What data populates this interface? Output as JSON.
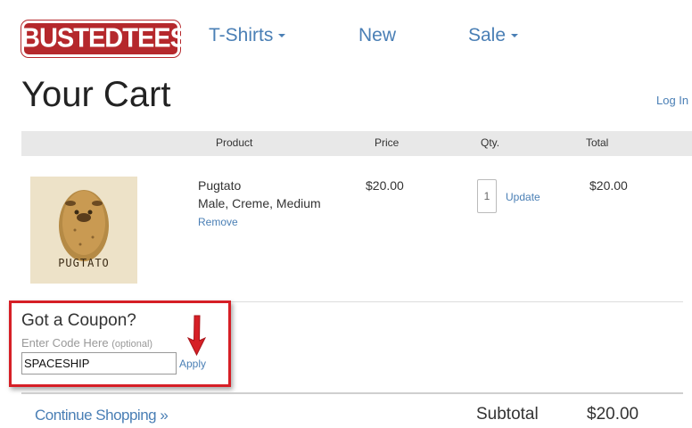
{
  "logo": {
    "text": "BUSTEDTEES"
  },
  "nav": {
    "items": [
      {
        "label": "T-Shirts",
        "has_dropdown": true
      },
      {
        "label": "New",
        "has_dropdown": false
      },
      {
        "label": "Sale",
        "has_dropdown": true
      }
    ]
  },
  "page": {
    "title": "Your Cart",
    "login_label": "Log In"
  },
  "table": {
    "headers": [
      "Product",
      "Price",
      "Qty.",
      "Total"
    ]
  },
  "cart_items": [
    {
      "image_caption": "PUGTATO",
      "name": "Pugtato",
      "variant": "Male, Creme, Medium",
      "remove_label": "Remove",
      "price": "$20.00",
      "quantity": "1",
      "update_label": "Update",
      "total": "$20.00"
    }
  ],
  "coupon": {
    "title": "Got a Coupon?",
    "label": "Enter Code Here",
    "label_hint": "(optional)",
    "code_value": "SPACESHIP",
    "apply_label": "Apply"
  },
  "footer": {
    "continue_label": "Continue Shopping »",
    "subtotal_label": "Subtotal",
    "subtotal_value": "$20.00"
  },
  "colors": {
    "link": "#4a7fb5",
    "brand": "#b5282c",
    "annotation": "#d61f26",
    "header_bg": "#e8e8e8"
  },
  "icons": [
    "chevron-down-icon",
    "red-arrow-icon",
    "pugtato-product-image"
  ]
}
